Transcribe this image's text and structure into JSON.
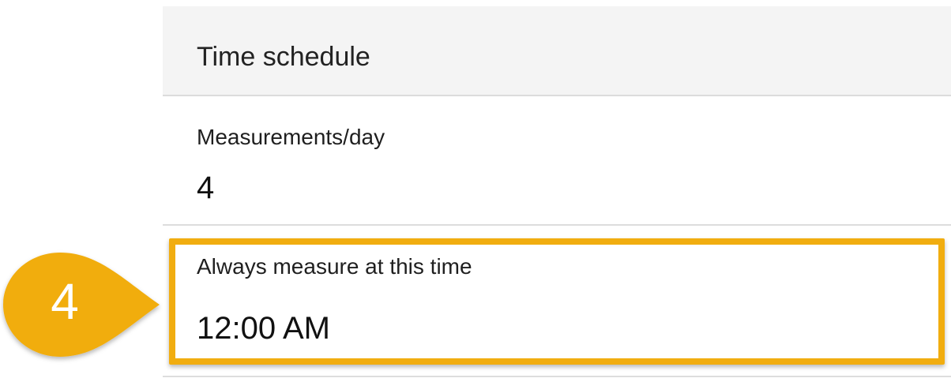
{
  "section": {
    "title": "Time schedule"
  },
  "fields": [
    {
      "label": "Measurements/day",
      "value": "4"
    },
    {
      "label": "Always measure at this time",
      "value": "12:00 AM"
    }
  ],
  "callout": {
    "number": "4",
    "color": "#f1ad10"
  }
}
